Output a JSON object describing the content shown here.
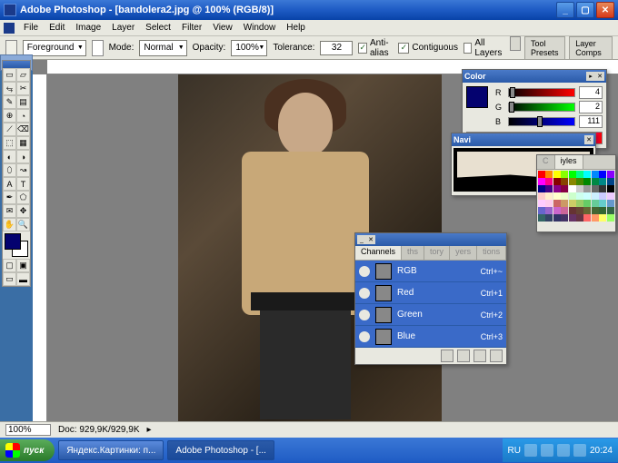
{
  "titlebar": {
    "text": "Adobe Photoshop - [bandolera2.jpg @ 100% (RGB/8)]"
  },
  "menu": [
    "File",
    "Edit",
    "Image",
    "Layer",
    "Select",
    "Filter",
    "View",
    "Window",
    "Help"
  ],
  "options": {
    "fill_mode": "Foreground",
    "mode_label": "Mode:",
    "mode_value": "Normal",
    "opacity_label": "Opacity:",
    "opacity_value": "100%",
    "tolerance_label": "Tolerance:",
    "tolerance_value": "32",
    "antialias_label": "Anti-alias",
    "antialias_checked": true,
    "contiguous_label": "Contiguous",
    "contiguous_checked": true,
    "alllayers_label": "All Layers",
    "alllayers_checked": false,
    "right_tabs": [
      "Tool Presets",
      "Layer Comps"
    ]
  },
  "color_panel": {
    "title": "Color",
    "foreground_hex": "#04026f",
    "sliders": [
      {
        "label": "R",
        "value": 4
      },
      {
        "label": "G",
        "value": 2
      },
      {
        "label": "B",
        "value": 111
      }
    ]
  },
  "navigator_panel": {
    "title": "Navi"
  },
  "swatches_panel": {
    "tab_inactive": "C",
    "tab_active": "iyles",
    "colors": [
      "#ff0000",
      "#ff8800",
      "#ffff00",
      "#88ff00",
      "#00ff00",
      "#00ff88",
      "#00ffff",
      "#0088ff",
      "#0000ff",
      "#8800ff",
      "#ff00ff",
      "#ff0088",
      "#880000",
      "#884400",
      "#888800",
      "#448800",
      "#008800",
      "#008844",
      "#008888",
      "#004488",
      "#000088",
      "#440088",
      "#880088",
      "#880044",
      "#ffffff",
      "#cccccc",
      "#999999",
      "#666666",
      "#333333",
      "#000000",
      "#ffcccc",
      "#ffeecc",
      "#ffffcc",
      "#eeffcc",
      "#ccffcc",
      "#ccffee",
      "#ccffff",
      "#cceeff",
      "#ccccff",
      "#eeccff",
      "#ffccff",
      "#ffccee",
      "#cc6666",
      "#cc9966",
      "#cccc66",
      "#99cc66",
      "#66cc66",
      "#66cc99",
      "#66cccc",
      "#6699cc",
      "#6666cc",
      "#9966cc",
      "#cc66cc",
      "#cc6699",
      "#663333",
      "#664433",
      "#666633",
      "#446633",
      "#336633",
      "#336644",
      "#336666",
      "#334466",
      "#333366",
      "#443366",
      "#663366",
      "#663344",
      "#ff6666",
      "#ff9966",
      "#ffff66",
      "#99ff66"
    ]
  },
  "channels_panel": {
    "tabs": [
      "Channels",
      "ths",
      "tory",
      "yers",
      "tions"
    ],
    "rows": [
      {
        "name": "RGB",
        "key": "Ctrl+~"
      },
      {
        "name": "Red",
        "key": "Ctrl+1"
      },
      {
        "name": "Green",
        "key": "Ctrl+2"
      },
      {
        "name": "Blue",
        "key": "Ctrl+3"
      }
    ]
  },
  "statusbar": {
    "zoom": "100%",
    "doc": "Doc: 929,9K/929,9K"
  },
  "taskbar": {
    "start": "пуск",
    "items": [
      {
        "label": "Яндекс.Картинки: п...",
        "active": false
      },
      {
        "label": "Adobe Photoshop - [...",
        "active": true
      }
    ],
    "lang": "RU",
    "time": "20:24"
  },
  "tools": [
    [
      "▭",
      "▱"
    ],
    [
      "⥃",
      "✂"
    ],
    [
      "✎",
      "▤"
    ],
    [
      "⊕",
      "◔"
    ],
    [
      "⟋",
      "⌫"
    ],
    [
      "⬚",
      "▦"
    ],
    [
      "◐",
      "◑"
    ],
    [
      "⬯",
      "↝"
    ],
    [
      "A",
      "T"
    ],
    [
      "✒",
      "⬠"
    ],
    [
      "✉",
      "✥"
    ],
    [
      "✋",
      "🔍"
    ]
  ]
}
